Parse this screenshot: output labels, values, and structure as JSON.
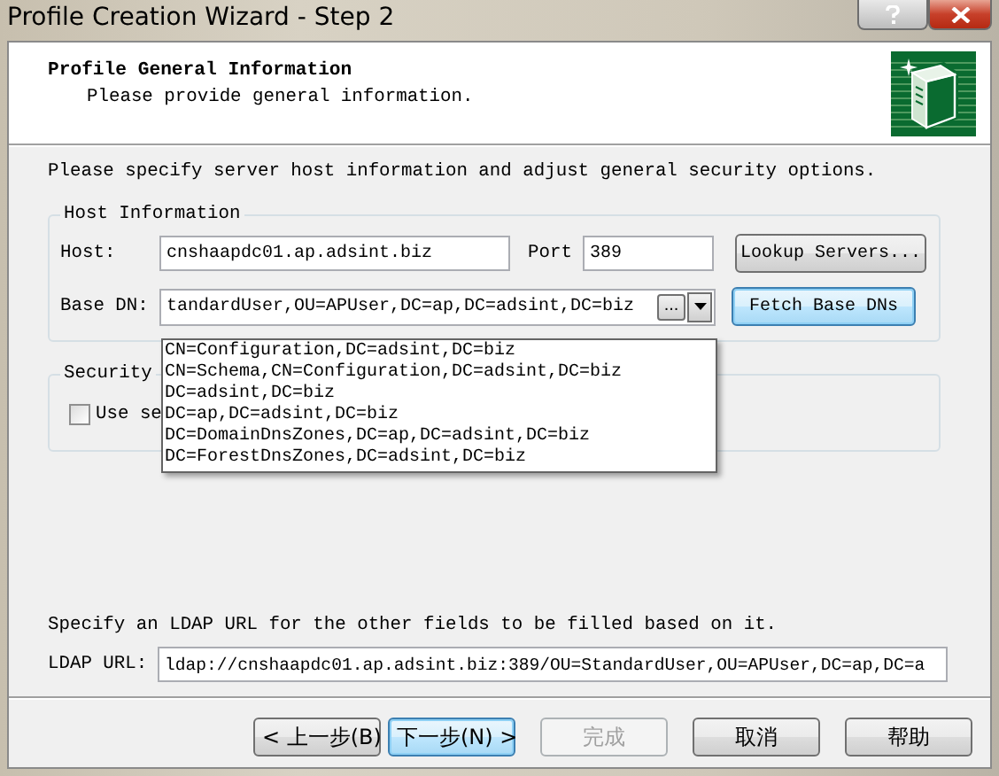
{
  "window": {
    "title": "Profile Creation Wizard - Step 2"
  },
  "header": {
    "title": "Profile General Information",
    "subtitle": "Please provide general information."
  },
  "intro": "Please specify server host information and adjust general security options.",
  "host_group": {
    "title": "Host Information",
    "host": {
      "label": "Host:",
      "value": "cnshaapdc01.ap.adsint.biz"
    },
    "port": {
      "label": "Port",
      "value": "389"
    },
    "lookup_button": "Lookup Servers...",
    "base_dn": {
      "label": "Base DN:",
      "value": "tandardUser,OU=APUser,DC=ap,DC=adsint,DC=biz",
      "browse_button": "...",
      "expanded": true,
      "options": [
        "CN=Configuration,DC=adsint,DC=biz",
        "CN=Schema,CN=Configuration,DC=adsint,DC=biz",
        "DC=adsint,DC=biz",
        "DC=ap,DC=adsint,DC=biz",
        "DC=DomainDnsZones,DC=ap,DC=adsint,DC=biz",
        "DC=ForestDnsZones,DC=adsint,DC=biz"
      ]
    },
    "fetch_button": {
      "label": "Fetch Base DNs",
      "focused": true
    }
  },
  "security_group": {
    "title": "Security",
    "checkbox": {
      "label": "Use se",
      "checked": false
    }
  },
  "ldap": {
    "hint": "Specify an LDAP URL for the other fields to be filled based on it.",
    "label": "LDAP URL:",
    "value": "ldap://cnshaapdc01.ap.adsint.biz:389/OU=StandardUser,OU=APUser,DC=ap,DC=a"
  },
  "buttons": [
    {
      "label": "< 上一步(B)",
      "disabled": false,
      "focused": false
    },
    {
      "label": "下一步(N) >",
      "disabled": false,
      "focused": true
    },
    {
      "label": "完成",
      "disabled": true,
      "focused": false
    },
    {
      "label": "取消",
      "disabled": false,
      "focused": false
    },
    {
      "label": "帮助",
      "disabled": false,
      "focused": false
    }
  ]
}
